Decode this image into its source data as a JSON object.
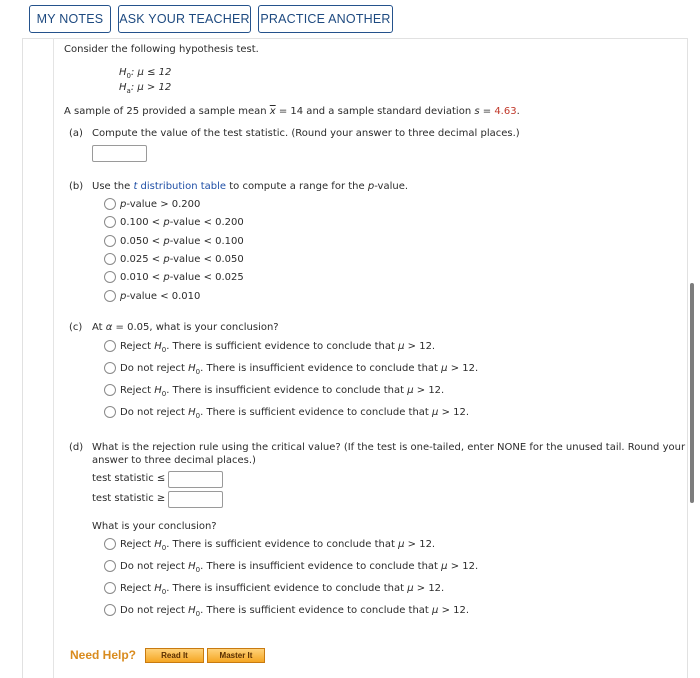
{
  "toolbar": {
    "my_notes": "MY NOTES",
    "ask_teacher": "ASK YOUR TEACHER",
    "practice_another": "PRACTICE ANOTHER"
  },
  "intro": "Consider the following hypothesis test.",
  "hypotheses": {
    "h0": ": μ ≤ 12",
    "ha": ": μ > 12"
  },
  "sample": {
    "prefix": "A sample of 25 provided a sample mean ",
    "mean_part": " = 14 and a sample standard deviation ",
    "s_part": " = ",
    "s_value": "4.63",
    "end": "."
  },
  "part_a": {
    "label": "(a)",
    "text": "Compute the value of the test statistic. (Round your answer to three decimal places.)",
    "answer": ""
  },
  "part_b": {
    "label": "(b)",
    "text_pre": "Use the ",
    "link": "t distribution table",
    "text_post": " to compute a range for the p-value.",
    "options": [
      "p-value > 0.200",
      "0.100 < p-value < 0.200",
      "0.050 < p-value < 0.100",
      "0.025 < p-value < 0.050",
      "0.010 < p-value < 0.025",
      "p-value < 0.010"
    ]
  },
  "part_c": {
    "label": "(c)",
    "question": "At α = 0.05, what is your conclusion?",
    "options": [
      {
        "a": "Reject H",
        "b": ". There is sufficient evidence to conclude that μ > 12."
      },
      {
        "a": "Do not reject H",
        "b": ". There is insufficient evidence to conclude that μ > 12."
      },
      {
        "a": "Reject H",
        "b": ". There is insufficient evidence to conclude that μ > 12."
      },
      {
        "a": "Do not reject H",
        "b": ". There is sufficient evidence to conclude that μ > 12."
      }
    ]
  },
  "part_d": {
    "label": "(d)",
    "text1": "What is the rejection rule using the critical value? (If the test is one-tailed, enter NONE for the unused tail. Round your",
    "text2": "answer to three decimal places.)",
    "ts_le": "test statistic ≤",
    "ts_ge": "test statistic ≥",
    "le_value": "",
    "ge_value": "",
    "conclusion_q": "What is your conclusion?",
    "options": [
      {
        "a": "Reject H",
        "b": ". There is sufficient evidence to conclude that μ > 12."
      },
      {
        "a": "Do not reject H",
        "b": ". There is insufficient evidence to conclude that μ > 12."
      },
      {
        "a": "Reject H",
        "b": ". There is insufficient evidence to conclude that μ > 12."
      },
      {
        "a": "Do not reject H",
        "b": ". There is sufficient evidence to conclude that μ > 12."
      }
    ]
  },
  "help": {
    "label": "Need Help?",
    "read_it": "Read It",
    "master_it": "Master It"
  }
}
